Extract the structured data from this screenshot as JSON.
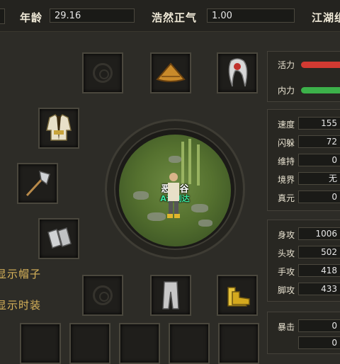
{
  "header": {
    "age_label": "年龄",
    "age_value": "29.16",
    "righteous_label": "浩然正气",
    "righteous_value": "1.00",
    "jianghu_label": "江湖组"
  },
  "character": {
    "name": "恶人谷",
    "guild": "A许划达"
  },
  "vitals": {
    "vitality_label": "活力",
    "vitality_color": "#d23a32",
    "inner_label": "内力",
    "inner_color": "#3cb14a"
  },
  "stats_group1": [
    {
      "label": "速度",
      "value": "155"
    },
    {
      "label": "闪躲",
      "value": "72"
    },
    {
      "label": "维持",
      "value": "0"
    },
    {
      "label": "境界",
      "value": "无"
    },
    {
      "label": "真元",
      "value": "0"
    }
  ],
  "stats_group2": [
    {
      "label": "身攻",
      "value": "1006"
    },
    {
      "label": "头攻",
      "value": "502"
    },
    {
      "label": "手攻",
      "value": "418"
    },
    {
      "label": "脚攻",
      "value": "433"
    }
  ],
  "stats_group3": [
    {
      "label": "暴击",
      "value": "0"
    },
    {
      "label": "",
      "value": "0"
    }
  ],
  "options": {
    "show_hat": "显示帽子",
    "show_fashion": "显示时装"
  },
  "equipment_slots": [
    {
      "slot": "empty-top-left"
    },
    {
      "slot": "hat",
      "icon": "straw-hat-icon"
    },
    {
      "slot": "hair",
      "icon": "white-hair-icon"
    },
    {
      "slot": "clothes",
      "icon": "robe-icon"
    },
    {
      "slot": "weapon",
      "icon": "axe-icon"
    },
    {
      "slot": "arm",
      "icon": "bracer-icon"
    },
    {
      "slot": "empty-bottom-left"
    },
    {
      "slot": "pants",
      "icon": "pants-icon"
    },
    {
      "slot": "shoes",
      "icon": "boots-icon"
    }
  ]
}
